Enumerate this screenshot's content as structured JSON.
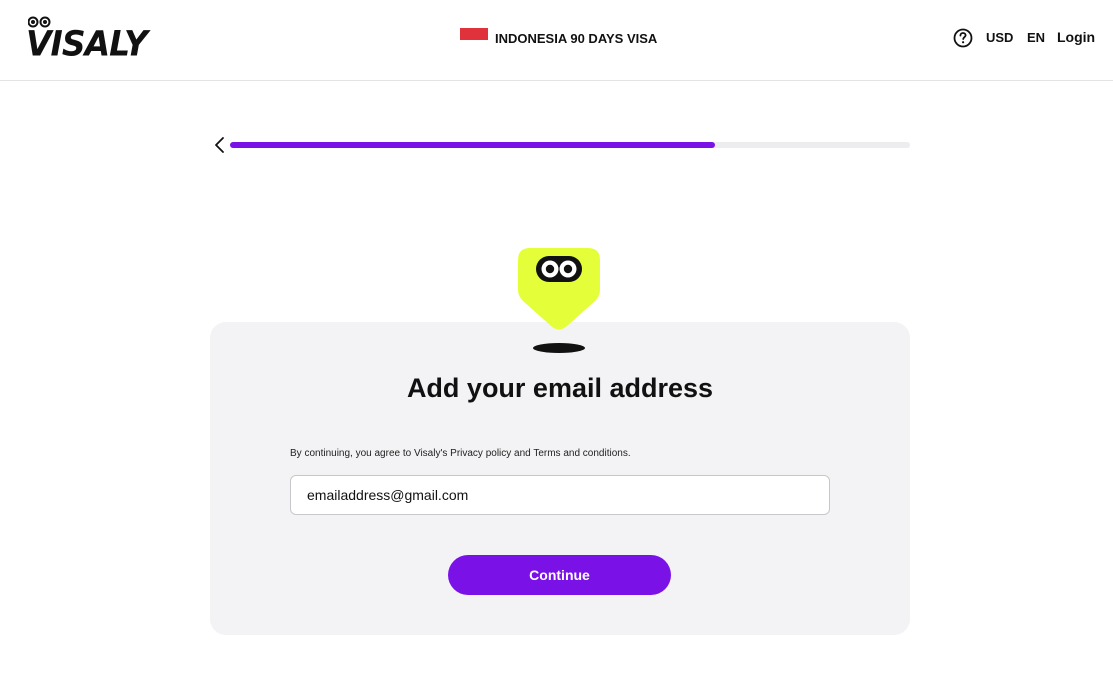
{
  "header": {
    "logo_text": "VISALY",
    "flag_color": "#e0323b",
    "visa_title": "INDONESIA 90 DAYS VISA",
    "help_icon": "question-circle-icon",
    "currency": "USD",
    "language": "EN",
    "login_label": "Login"
  },
  "progress": {
    "back_icon": "chevron-left-icon",
    "value": 0.713,
    "accent": "#7a12e8"
  },
  "card": {
    "mascot": "visaly-mascot-icon",
    "mascot_color": "#e4ff3a",
    "title": "Add your email address",
    "consent_text": "By continuing, you agree to Visaly's Privacy policy and Terms and conditions.",
    "email_value": "emailaddress@gmail.com",
    "continue_label": "Continue"
  }
}
